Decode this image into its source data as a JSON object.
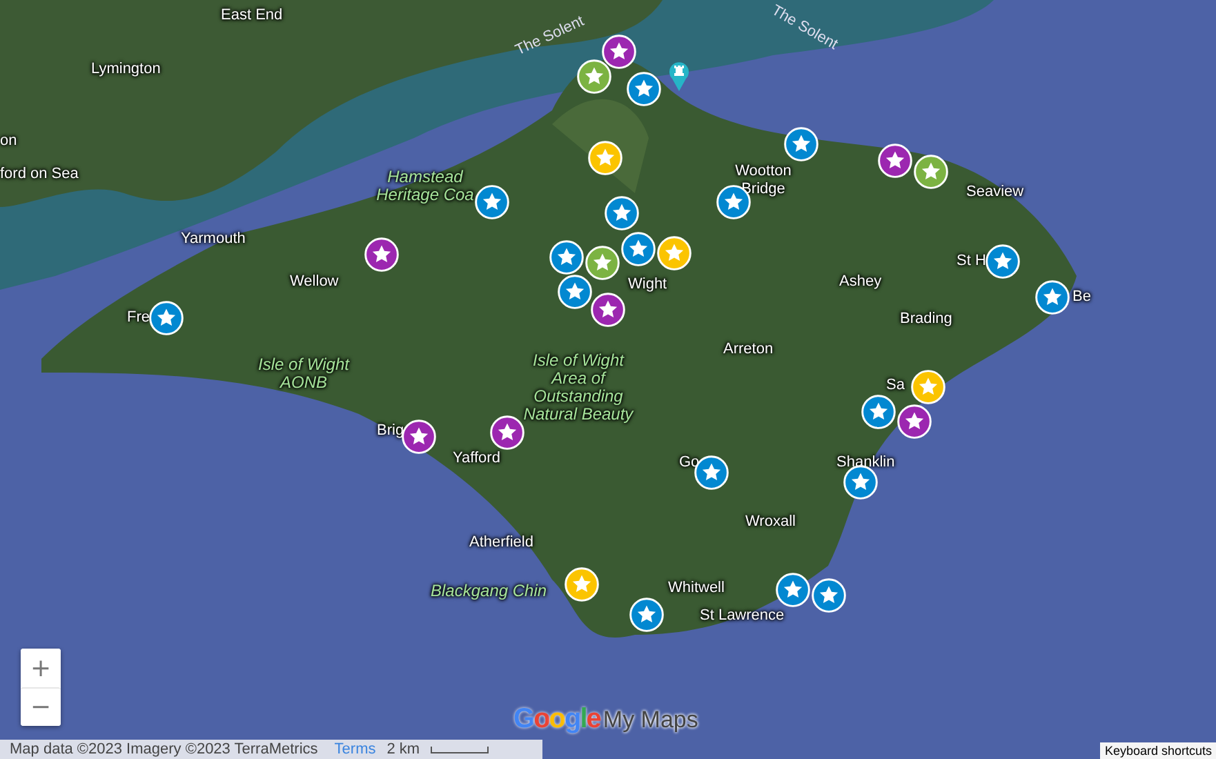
{
  "map": {
    "labels": [
      {
        "text": "East End",
        "kind": "place"
      },
      {
        "text": "Lymington",
        "kind": "place"
      },
      {
        "text": "on",
        "kind": "place"
      },
      {
        "text": "ford on Sea",
        "kind": "place"
      },
      {
        "text": "The Solent",
        "kind": "water"
      },
      {
        "text": "The Solent",
        "kind": "water"
      },
      {
        "text": "Hamstead Heritage Coa",
        "kind": "park"
      },
      {
        "text": "Yarmouth",
        "kind": "place"
      },
      {
        "text": "Wellow",
        "kind": "place"
      },
      {
        "text": "Fre",
        "kind": "place"
      },
      {
        "text": "Wight",
        "kind": "place"
      },
      {
        "text": "Wootton Bridge",
        "kind": "place"
      },
      {
        "text": "Seaview",
        "kind": "place"
      },
      {
        "text": "St H",
        "kind": "place"
      },
      {
        "text": "Be",
        "kind": "place"
      },
      {
        "text": "Ashey",
        "kind": "place"
      },
      {
        "text": "Brading",
        "kind": "place"
      },
      {
        "text": "Arreton",
        "kind": "place"
      },
      {
        "text": "Isle of Wight AONB",
        "kind": "park"
      },
      {
        "text": "Isle of Wight Area of Outstanding Natural Beauty",
        "kind": "park"
      },
      {
        "text": "Brig",
        "kind": "place"
      },
      {
        "text": "Yafford",
        "kind": "place"
      },
      {
        "text": "Sa",
        "kind": "place"
      },
      {
        "text": "Go",
        "kind": "place"
      },
      {
        "text": "Shanklin",
        "kind": "place"
      },
      {
        "text": "Wroxall",
        "kind": "place"
      },
      {
        "text": "Atherfield",
        "kind": "place"
      },
      {
        "text": "Blackgang Chin",
        "kind": "park"
      },
      {
        "text": "Whitwell",
        "kind": "place"
      },
      {
        "text": "St Lawrence",
        "kind": "place"
      }
    ],
    "pins": [
      {
        "kind": "star",
        "color": "#9c27b0"
      },
      {
        "kind": "star",
        "color": "#7cb342"
      },
      {
        "kind": "star",
        "color": "#0288d1"
      },
      {
        "kind": "castle",
        "color": "#26b5c7"
      },
      {
        "kind": "star",
        "color": "#fbc400"
      },
      {
        "kind": "star",
        "color": "#0288d1"
      },
      {
        "kind": "star",
        "color": "#7cb342"
      },
      {
        "kind": "star",
        "color": "#9c27b0"
      },
      {
        "kind": "star",
        "color": "#0288d1"
      },
      {
        "kind": "star",
        "color": "#0288d1"
      },
      {
        "kind": "star",
        "color": "#0288d1"
      },
      {
        "kind": "star",
        "color": "#9c27b0"
      },
      {
        "kind": "star",
        "color": "#fbc400"
      },
      {
        "kind": "star",
        "color": "#0288d1"
      },
      {
        "kind": "star",
        "color": "#7cb342"
      },
      {
        "kind": "star",
        "color": "#0288d1"
      },
      {
        "kind": "star",
        "color": "#0288d1"
      },
      {
        "kind": "star",
        "color": "#9c27b0"
      },
      {
        "kind": "star",
        "color": "#0288d1"
      },
      {
        "kind": "star",
        "color": "#0288d1"
      },
      {
        "kind": "star",
        "color": "#0288d1"
      },
      {
        "kind": "star",
        "color": "#fbc400"
      },
      {
        "kind": "star",
        "color": "#0288d1"
      },
      {
        "kind": "star",
        "color": "#9c27b0"
      },
      {
        "kind": "star",
        "color": "#9c27b0"
      },
      {
        "kind": "star",
        "color": "#9c27b0"
      },
      {
        "kind": "star",
        "color": "#0288d1"
      },
      {
        "kind": "star",
        "color": "#0288d1"
      },
      {
        "kind": "star",
        "color": "#fbc400"
      },
      {
        "kind": "star",
        "color": "#0288d1"
      },
      {
        "kind": "star",
        "color": "#0288d1"
      },
      {
        "kind": "star",
        "color": "#0288d1"
      }
    ]
  },
  "zoom_controls": [
    {
      "label": "+"
    },
    {
      "label": "−"
    }
  ],
  "logo": {
    "brand": "Google",
    "product": "My Maps"
  },
  "footer": {
    "attribution": "Map data ©2023 Imagery ©2023 TerraMetrics",
    "terms": "Terms",
    "scale": "2 km",
    "shortcuts": "Keyboard shortcuts"
  }
}
